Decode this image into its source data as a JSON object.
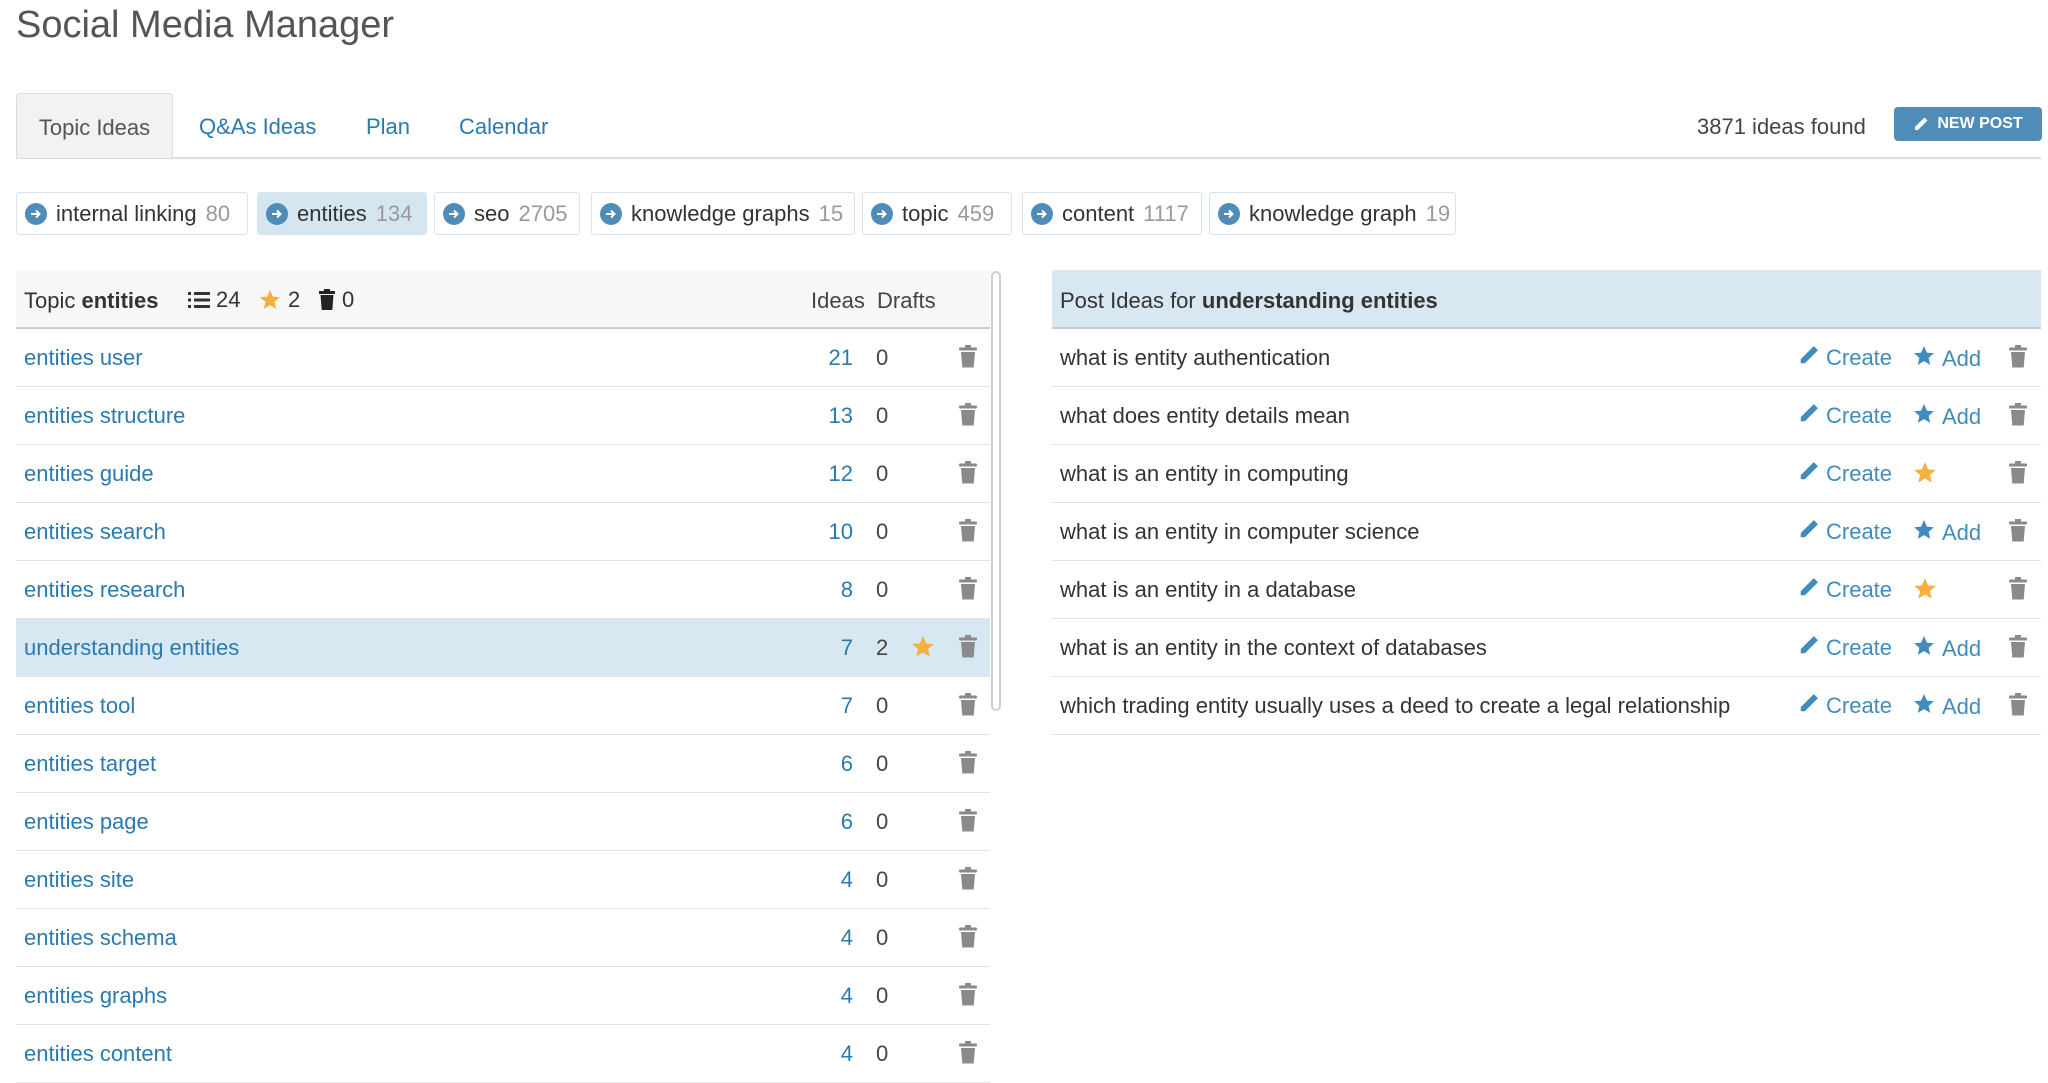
{
  "app_title": "Social Media Manager",
  "tabs": [
    {
      "label": "Topic Ideas",
      "active": true
    },
    {
      "label": "Q&As Ideas",
      "active": false
    },
    {
      "label": "Plan",
      "active": false
    },
    {
      "label": "Calendar",
      "active": false
    }
  ],
  "ideas_found": "3871 ideas found",
  "new_post_label": "NEW POST",
  "chips": [
    {
      "label": "internal linking",
      "count": "80",
      "active": false
    },
    {
      "label": "entities",
      "count": "134",
      "active": true
    },
    {
      "label": "seo",
      "count": "2705",
      "active": false
    },
    {
      "label": "knowledge graphs",
      "count": "15",
      "active": false
    },
    {
      "label": "topic",
      "count": "459",
      "active": false
    },
    {
      "label": "content",
      "count": "1117",
      "active": false
    },
    {
      "label": "knowledge graph",
      "count": "19",
      "active": false
    }
  ],
  "topic_table": {
    "label_prefix": "Topic",
    "topic": "entities",
    "list_count": "24",
    "star_count": "2",
    "trash_count": "0",
    "col_ideas": "Ideas",
    "col_drafts": "Drafts",
    "rows": [
      {
        "name": "entities user",
        "ideas": "21",
        "drafts": "0",
        "starred": false,
        "selected": false
      },
      {
        "name": "entities structure",
        "ideas": "13",
        "drafts": "0",
        "starred": false,
        "selected": false
      },
      {
        "name": "entities guide",
        "ideas": "12",
        "drafts": "0",
        "starred": false,
        "selected": false
      },
      {
        "name": "entities search",
        "ideas": "10",
        "drafts": "0",
        "starred": false,
        "selected": false
      },
      {
        "name": "entities research",
        "ideas": "8",
        "drafts": "0",
        "starred": false,
        "selected": false
      },
      {
        "name": "understanding entities",
        "ideas": "7",
        "drafts": "2",
        "starred": true,
        "selected": true
      },
      {
        "name": "entities tool",
        "ideas": "7",
        "drafts": "0",
        "starred": false,
        "selected": false
      },
      {
        "name": "entities target",
        "ideas": "6",
        "drafts": "0",
        "starred": false,
        "selected": false
      },
      {
        "name": "entities page",
        "ideas": "6",
        "drafts": "0",
        "starred": false,
        "selected": false
      },
      {
        "name": "entities site",
        "ideas": "4",
        "drafts": "0",
        "starred": false,
        "selected": false
      },
      {
        "name": "entities schema",
        "ideas": "4",
        "drafts": "0",
        "starred": false,
        "selected": false
      },
      {
        "name": "entities graphs",
        "ideas": "4",
        "drafts": "0",
        "starred": false,
        "selected": false
      },
      {
        "name": "entities content",
        "ideas": "4",
        "drafts": "0",
        "starred": false,
        "selected": false
      }
    ]
  },
  "post_ideas": {
    "label_prefix": "Post Ideas for",
    "topic": "understanding entities",
    "create_label": "Create",
    "add_label": "Add",
    "rows": [
      {
        "text": "what is entity authentication",
        "added": false
      },
      {
        "text": "what does entity details mean",
        "added": false
      },
      {
        "text": "what is an entity in computing",
        "added": true
      },
      {
        "text": "what is an entity in computer science",
        "added": false
      },
      {
        "text": "what is an entity in a database",
        "added": true
      },
      {
        "text": "what is an entity in the context of databases",
        "added": false
      },
      {
        "text": "which trading entity usually uses a deed to create a legal relationship",
        "added": false
      }
    ]
  },
  "colors": {
    "accent": "#2a7ab0",
    "button": "#4f8db8",
    "selected_row": "#d8e8f2",
    "star": "#f5b041",
    "trash": "#8a8a8a"
  }
}
